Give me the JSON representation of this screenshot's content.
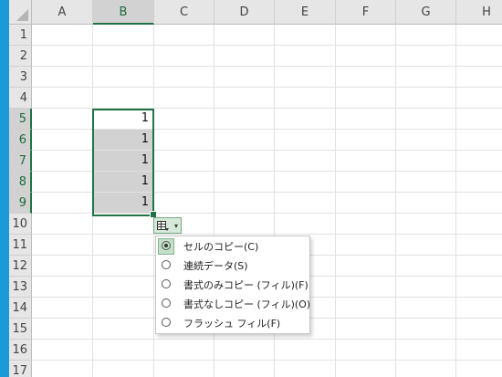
{
  "columns": [
    "A",
    "B",
    "C",
    "D",
    "E",
    "F",
    "G",
    "H"
  ],
  "selected_column": "B",
  "rows": [
    "1",
    "2",
    "3",
    "4",
    "5",
    "6",
    "7",
    "8",
    "9",
    "10",
    "11",
    "12",
    "13",
    "14",
    "15",
    "16",
    "17"
  ],
  "selected_rows": [
    "5",
    "6",
    "7",
    "8",
    "9"
  ],
  "cells": {
    "B5": "1",
    "B6": "1",
    "B7": "1",
    "B8": "1",
    "B9": "1"
  },
  "autofill_menu": {
    "button_icon": "autofill-options-icon",
    "items": [
      {
        "label": "セルのコピー(C)",
        "checked": true
      },
      {
        "label": "連続データ(S)",
        "checked": false
      },
      {
        "label": "書式のみコピー (フィル)(F)",
        "checked": false
      },
      {
        "label": "書式なしコピー (フィル)(O)",
        "checked": false
      },
      {
        "label": "フラッシュ フィル(F)",
        "checked": false
      }
    ]
  },
  "colors": {
    "selection": "#217346",
    "accent_bar": "#1a9bd7",
    "selected_fill": "#d2d2d2"
  }
}
